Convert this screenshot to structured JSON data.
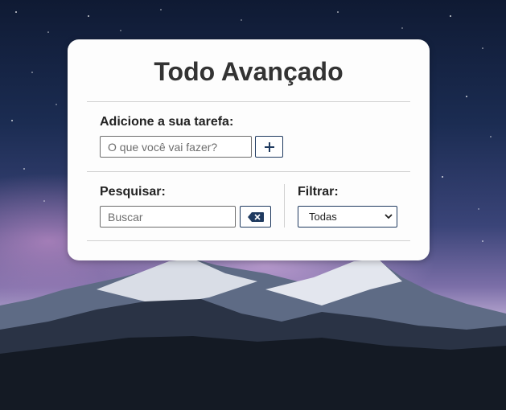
{
  "app": {
    "title": "Todo Avançado"
  },
  "add_section": {
    "label": "Adicione a sua tarefa:",
    "input_placeholder": "O que você vai fazer?",
    "add_button_icon": "plus-icon"
  },
  "search_section": {
    "label": "Pesquisar:",
    "input_placeholder": "Buscar",
    "clear_button_icon": "backspace-icon"
  },
  "filter_section": {
    "label": "Filtrar:",
    "selected": "Todas",
    "dropdown_icon": "chevron-down-icon"
  },
  "colors": {
    "accent": "#1f3a5f",
    "card_background": "#fdfdfd",
    "title_text": "#333333"
  }
}
